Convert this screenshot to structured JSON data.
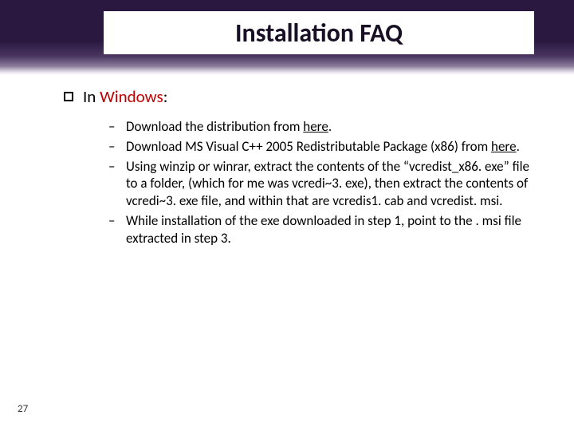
{
  "title": "Installation FAQ",
  "heading": {
    "prefix": "In ",
    "highlight": "Windows",
    "suffix": ":"
  },
  "items": {
    "i1_a": "Download the distribution from ",
    "i1_link": "here",
    "i1_b": ".",
    "i2_a": "Download MS Visual C++ 2005 Redistributable Package (x86) from ",
    "i2_link": "here",
    "i2_b": ".",
    "i3": "Using winzip or winrar, extract the contents of the “vcredist_x86. exe” file to a folder, (which for me was vcredi~3. exe), then extract the contents of vcredi~3. exe file, and within that are vcredis1. cab and vcredist. msi.",
    "i4": "While installation of the exe downloaded in step 1, point to the . msi file extracted in step 3."
  },
  "page_number": "27"
}
